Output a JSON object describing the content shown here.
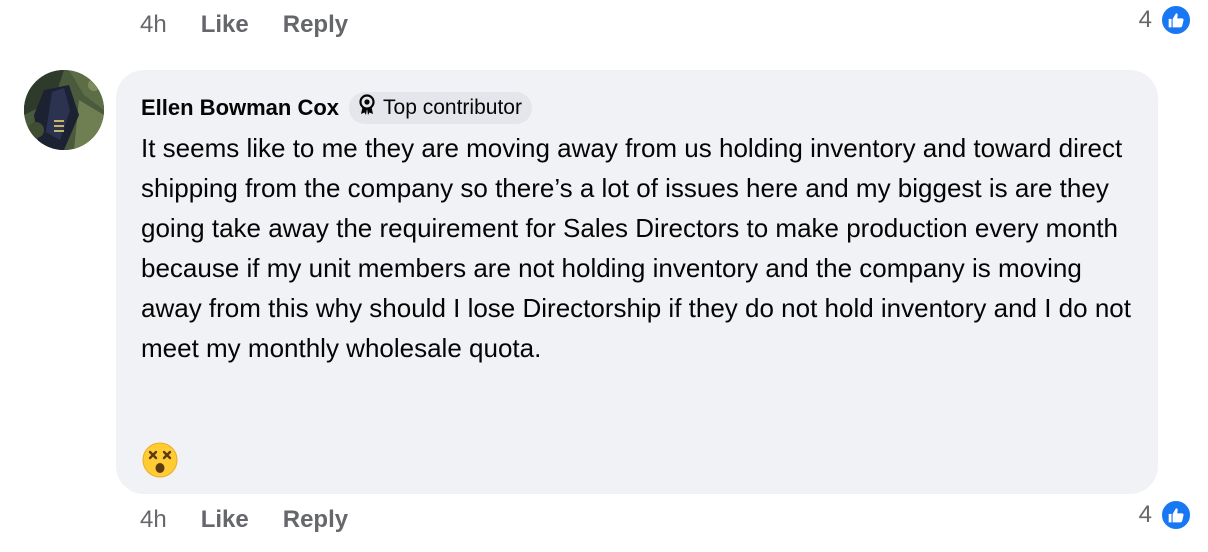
{
  "top_actions": {
    "time": "4h",
    "like_label": "Like",
    "reply_label": "Reply",
    "reaction_count": "4",
    "reaction_icon": "thumbs-up-icon"
  },
  "comment": {
    "author": "Ellen Bowman Cox",
    "badge_label": "Top contributor",
    "badge_icon": "award-ribbon-icon",
    "text": "It seems like to me they are moving away from us holding inventory and toward direct shipping from the company so there’s a lot of issues here and my biggest is are they going take away the requirement for Sales Directors to make production every month because if my unit members are not holding inventory and the company is moving away from this why should I lose Directorship if they do not hold inventory and I do not meet my monthly wholesale quota.",
    "emoji": "dizzy-face-emoji"
  },
  "bottom_actions": {
    "time": "4h",
    "like_label": "Like",
    "reply_label": "Reply",
    "reaction_count": "4",
    "reaction_icon": "thumbs-up-icon"
  },
  "colors": {
    "bubble_bg": "#f0f2f5",
    "meta_text": "#65676b",
    "like_blue": "#1877f2"
  }
}
